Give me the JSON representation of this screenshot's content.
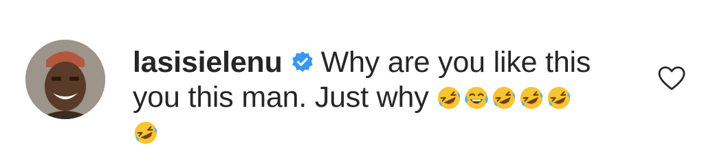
{
  "comment": {
    "username": "lasisielenu",
    "verified": true,
    "text": "Why are you like this you this man. Just why",
    "emojis": [
      "rolling-on-floor-laughing",
      "face-with-tears-of-joy",
      "rolling-on-floor-laughing",
      "rolling-on-floor-laughing",
      "rolling-on-floor-laughing",
      "rolling-on-floor-laughing"
    ],
    "avatar_icon": "user-avatar",
    "like_icon": "heart-outline-icon"
  },
  "colors": {
    "text": "#262626",
    "verified_badge": "#3897f0",
    "emoji_face": "#f7c531",
    "tears": "#5ab4f0",
    "heart_stroke": "#262626",
    "background": "#ffffff"
  }
}
